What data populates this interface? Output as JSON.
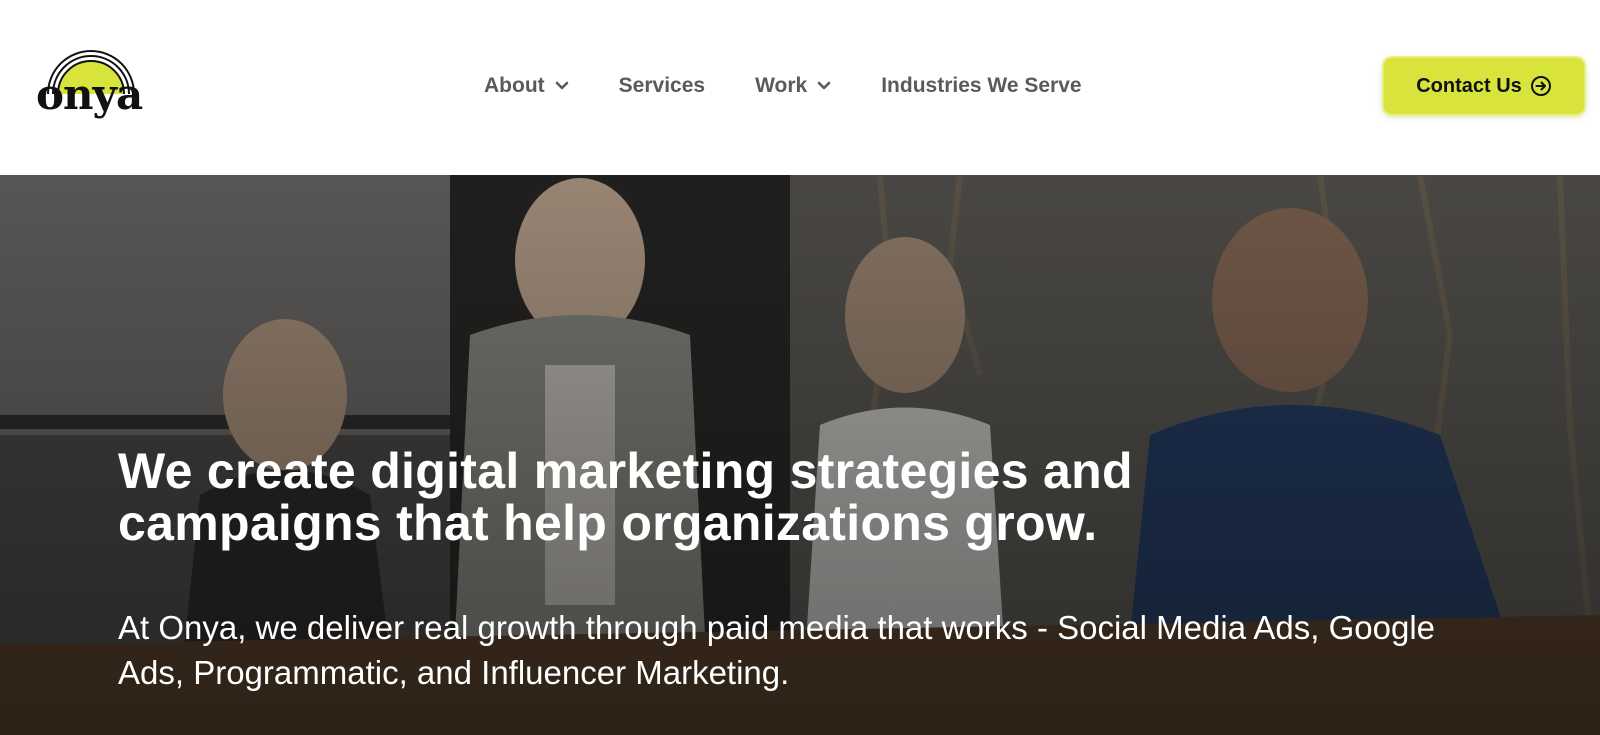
{
  "brand": {
    "logo_text": "onya",
    "accent_color": "#d8e43c"
  },
  "nav": {
    "items": [
      {
        "label": "About",
        "has_dropdown": true
      },
      {
        "label": "Services",
        "has_dropdown": false
      },
      {
        "label": "Work",
        "has_dropdown": true
      },
      {
        "label": "Industries We Serve",
        "has_dropdown": false
      }
    ]
  },
  "header": {
    "contact_label": "Contact Us",
    "contact_icon": "arrow-right-circle-icon"
  },
  "hero": {
    "title_line1": "We create digital marketing strategies and",
    "title_line2": "campaigns that help organizations grow.",
    "subtitle": "At Onya, we deliver real growth through paid media that works - Social Media Ads, Google Ads, Programmatic, and Influencer Marketing."
  }
}
